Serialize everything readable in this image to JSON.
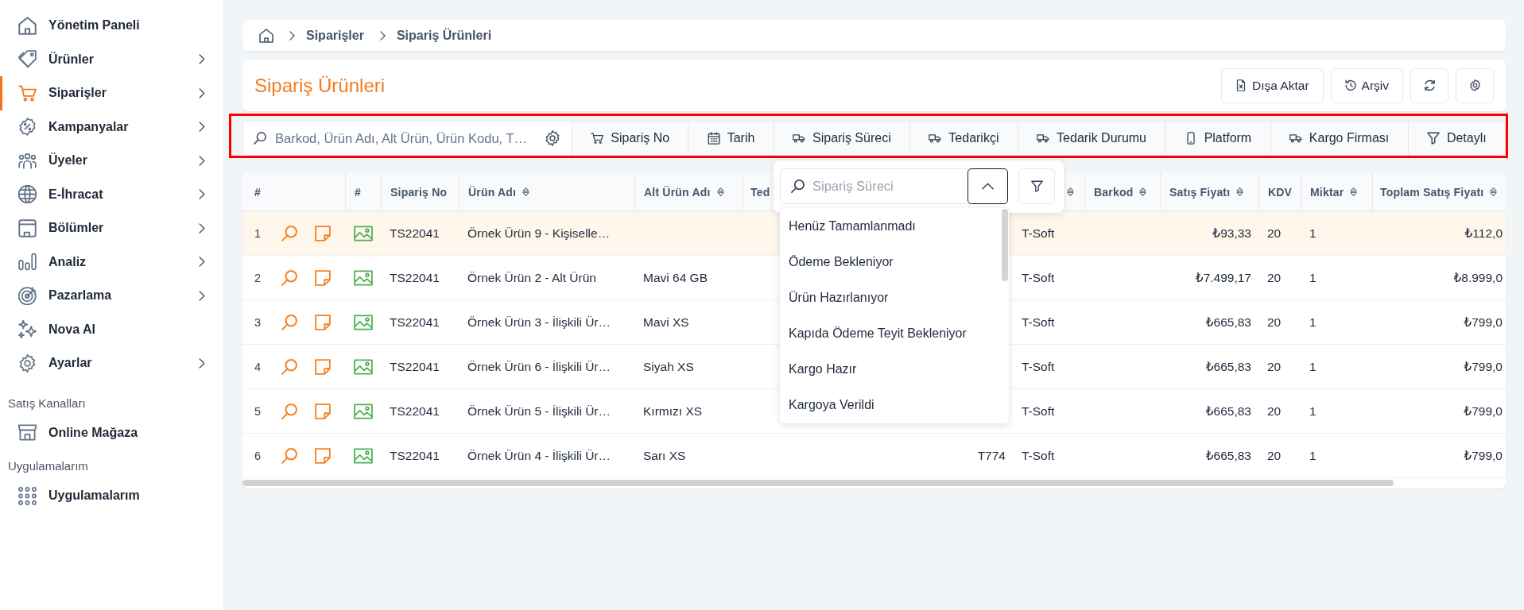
{
  "sidebar": {
    "items": [
      {
        "label": "Yönetim Paneli",
        "kind": "dashboard",
        "selected": false,
        "expandable": false
      },
      {
        "label": "Ürünler",
        "kind": "products",
        "selected": false,
        "expandable": true
      },
      {
        "label": "Siparişler",
        "kind": "orders",
        "selected": true,
        "expandable": true
      },
      {
        "label": "Kampanyalar",
        "kind": "campaigns",
        "selected": false,
        "expandable": true
      },
      {
        "label": "Üyeler",
        "kind": "members",
        "selected": false,
        "expandable": true
      },
      {
        "label": "E-İhracat",
        "kind": "export",
        "selected": false,
        "expandable": true
      },
      {
        "label": "Bölümler",
        "kind": "sections",
        "selected": false,
        "expandable": true
      },
      {
        "label": "Analiz",
        "kind": "analytics",
        "selected": false,
        "expandable": true
      },
      {
        "label": "Pazarlama",
        "kind": "marketing",
        "selected": false,
        "expandable": true
      },
      {
        "label": "Nova AI",
        "kind": "ai",
        "selected": false,
        "expandable": false
      },
      {
        "label": "Ayarlar",
        "kind": "settings",
        "selected": false,
        "expandable": true
      }
    ],
    "sections": [
      {
        "title": "Satış Kanalları",
        "items": [
          {
            "label": "Online Mağaza",
            "kind": "store",
            "selected": false,
            "expandable": false
          }
        ]
      },
      {
        "title": "Uygulamalarım",
        "items": [
          {
            "label": "Uygulamalarım",
            "kind": "apps",
            "selected": false,
            "expandable": false
          }
        ]
      }
    ]
  },
  "breadcrumb": {
    "items": [
      "Siparişler",
      "Sipariş Ürünleri"
    ]
  },
  "page_header": {
    "title": "Sipariş Ürünleri",
    "actions": [
      {
        "kind": "export",
        "label": "Dışa Aktar"
      },
      {
        "kind": "archive",
        "label": "Arşiv"
      },
      {
        "kind": "refresh"
      },
      {
        "kind": "settings"
      }
    ]
  },
  "filter_bar": {
    "highlighted": true,
    "search": {
      "placeholder": "Barkod, Ürün Adı, Alt Ürün, Ürün Kodu, T…"
    },
    "filters": [
      {
        "kind": "order",
        "label": "Sipariş No"
      },
      {
        "kind": "date",
        "label": "Tarih"
      },
      {
        "kind": "logistics",
        "label": "Sipariş Süreci"
      },
      {
        "kind": "logistics",
        "label": "Tedarikçi"
      },
      {
        "kind": "logistics",
        "label": "Tedarik Durumu"
      },
      {
        "kind": "device",
        "label": "Platform"
      },
      {
        "kind": "logistics",
        "label": "Kargo Firması"
      },
      {
        "kind": "advanced",
        "label": "Detaylı"
      }
    ]
  },
  "process_dropdown": {
    "placeholder": "Sipariş Süreci",
    "expanded": true,
    "options": [
      {
        "label": "Henüz Tamamlanmadı",
        "selected": false
      },
      {
        "label": "Ödeme Bekleniyor",
        "selected": false
      },
      {
        "label": "Ürün Hazırlanıyor",
        "selected": false
      },
      {
        "label": "Kapıda Ödeme Teyit Bekleniyor",
        "selected": false
      },
      {
        "label": "Kargo Hazır",
        "selected": false
      },
      {
        "label": "Kargoya Verildi",
        "selected": false
      }
    ]
  },
  "table": {
    "columns": [
      {
        "label": "#",
        "sortable": false
      },
      {
        "label": "#",
        "sortable": false
      },
      {
        "label": "Sipariş No",
        "sortable": false
      },
      {
        "label": "Ürün Adı",
        "sortable": true
      },
      {
        "label": "Alt Ürün Adı",
        "sortable": true
      },
      {
        "label": "Ted",
        "sortable": false
      },
      {},
      {
        "sortable": true
      },
      {
        "label": "Barkod",
        "sortable": true
      },
      {
        "label": "Satış Fiyatı",
        "sortable": true
      },
      {
        "label": "KDV",
        "sortable": false
      },
      {
        "label": "Miktar",
        "sortable": true
      },
      {
        "label": "Toplam Satış Fiyatı",
        "sortable": true
      }
    ],
    "rows": [
      {
        "number": "1",
        "selected": true,
        "order_no": "TS22041",
        "product_name": "Örnek Ürün 9 - Kişiselle…",
        "column_8": "T-Soft",
        "sale_price": "₺93,33",
        "vat": "20",
        "quantity": "1",
        "total_sale_price": "₺112,0"
      },
      {
        "number": "2",
        "selected": false,
        "order_no": "TS22041",
        "product_name": "Örnek Ürün 2 - Alt Ürün",
        "sub_product_name": "Mavi 64 GB",
        "column_8": "T-Soft",
        "sale_price": "₺7.499,17",
        "vat": "20",
        "quantity": "1",
        "total_sale_price": "₺8.999,0"
      },
      {
        "number": "3",
        "selected": false,
        "order_no": "TS22041",
        "product_name": "Örnek Ürün 3 - İlişkili Ür…",
        "sub_product_name": "Mavi XS",
        "column_8": "T-Soft",
        "sale_price": "₺665,83",
        "vat": "20",
        "quantity": "1",
        "total_sale_price": "₺799,0"
      },
      {
        "number": "4",
        "selected": false,
        "order_no": "TS22041",
        "product_name": "Örnek Ürün 6 - İlişkili Ür…",
        "sub_product_name": "Siyah XS",
        "column_8": "T-Soft",
        "sale_price": "₺665,83",
        "vat": "20",
        "quantity": "1",
        "total_sale_price": "₺799,0"
      },
      {
        "number": "5",
        "selected": false,
        "order_no": "TS22041",
        "product_name": "Örnek Ürün 5 - İlişkili Ür…",
        "sub_product_name": "Kırmızı XS",
        "column_8": "T-Soft",
        "sale_price": "₺665,83",
        "vat": "20",
        "quantity": "1",
        "total_sale_price": "₺799,0"
      },
      {
        "number": "6",
        "selected": false,
        "order_no": "TS22041",
        "product_name": "Örnek Ürün 4 - İlişkili Ür…",
        "sub_product_name": "Sarı XS",
        "column_7": "T774",
        "column_8": "T-Soft",
        "sale_price": "₺665,83",
        "vat": "20",
        "quantity": "1",
        "total_sale_price": "₺799,0"
      }
    ]
  }
}
